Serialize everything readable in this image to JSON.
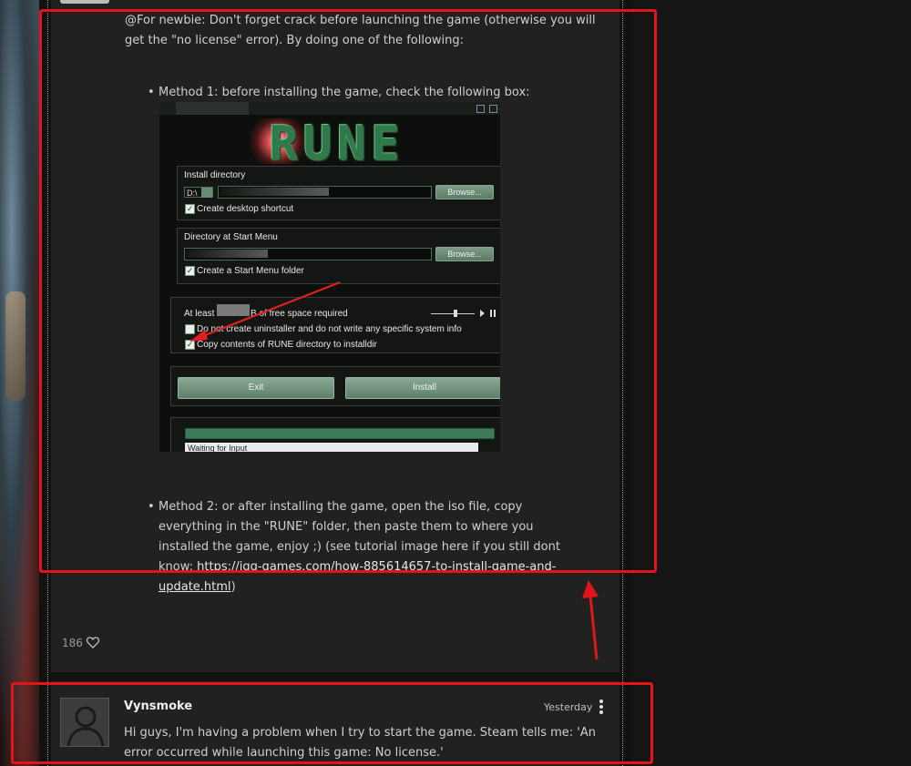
{
  "post": {
    "intro": "@For newbie: Don't forget crack before launching the game (otherwise you will get the \"no license\" error). By doing one of the following:",
    "method1": "Method 1: before installing the game, check the following box:",
    "method2_text": "Method 2: or after installing the game, open the iso file, copy everything in the \"RUNE\" folder, then paste them to where you installed the game, enjoy ;) (see tutorial image here if you still dont know: ",
    "method2_link": "https://igg-games.com/how-885614657-to-install-game-and-update.html",
    "method2_close": ")",
    "likes": "186"
  },
  "installer": {
    "title": "RUNE",
    "install_directory_label": "Install directory",
    "drive_value": "D:\\",
    "browse_label": "Browse...",
    "desktop_shortcut_label": "Create desktop shortcut",
    "start_menu_label": "Directory at Start Menu",
    "start_menu_folder_label": "Create a Start Menu folder",
    "space_label_a": "At least",
    "space_label_b": "B of free space required",
    "no_uninstaller_label": "Do not create uninstaller and do not write any specific system info",
    "copy_contents_label": "Copy contents of RUNE directory to installdir",
    "exit_label": "Exit",
    "install_label": "Install",
    "status_text": "Waiting for Input",
    "check_glyph": "✓"
  },
  "comment": {
    "username": "Vynsmoke",
    "date": "Yesterday",
    "text": "Hi guys, I'm having a problem when I try to start the game. Steam tells me: 'An error occurred while launching this game: No license.'"
  },
  "icons": {
    "heart": "heart-icon",
    "more": "more-vertical-icon",
    "avatar": "user-avatar-icon"
  },
  "colors": {
    "highlight": "#e3141b",
    "card_bg": "#212121",
    "installer_green": "#3e7c58"
  }
}
